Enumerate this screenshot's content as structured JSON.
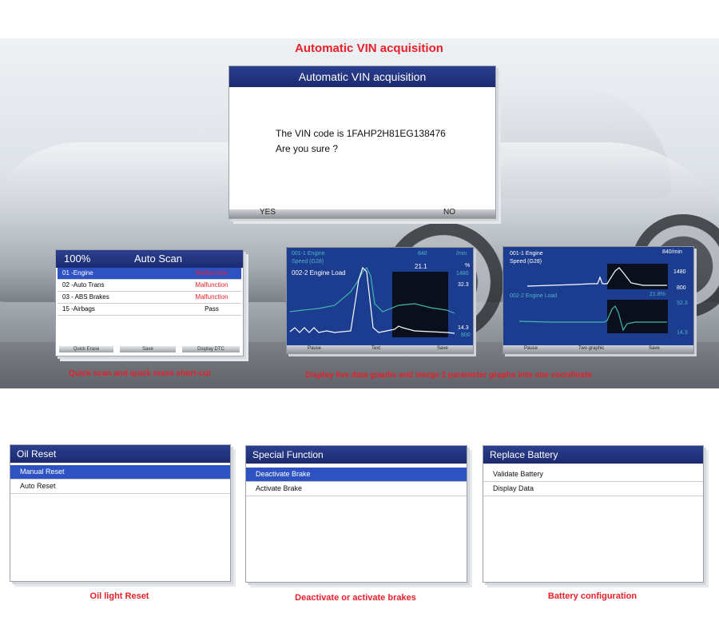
{
  "hero": {
    "title": "Automatic VIN acquisition",
    "caption_left": "Quick scan and quick erase short-cut",
    "caption_right": "Display live data graphs and merge 2 parameter graphs into one coordinate"
  },
  "vin_dialog": {
    "title": "Automatic VIN acquisition",
    "line1": "The VIN code is 1FAHP2H81EG138476",
    "line2": "Are you sure ?",
    "yes": "YES",
    "no": "NO"
  },
  "auto_scan": {
    "percent": "100%",
    "title": "Auto Scan",
    "rows": [
      {
        "name": "01 -Engine",
        "status": "Malfunction"
      },
      {
        "name": "02 -Auto Trans",
        "status": "Malfunction"
      },
      {
        "name": "03 - ABS Brakes",
        "status": "Malfunction"
      },
      {
        "name": "15 -Airbags",
        "status": "Pass"
      }
    ],
    "buttons": [
      "Quick Erase",
      "Save",
      "Display DTC"
    ]
  },
  "graph1": {
    "p1": "001-1  Engine",
    "p1b": "Speed (G28)",
    "p1_unit": "/min",
    "p1_val": "840",
    "p2": "002-2  Engine Load",
    "p2_val": "21.1",
    "p2_unit": "%",
    "v_1480": "1480",
    "v_323": "32.3",
    "v_143": "14.3",
    "v_800": "800",
    "buttons": [
      "Pause",
      "Text",
      "Save"
    ]
  },
  "graph2": {
    "p1": "001-1  Engine",
    "p1b": "Speed (G28)",
    "p1_val": "840/min",
    "p2": "002-2 Engine Load",
    "p2_val": "21.8%",
    "v_1480": "1480",
    "v_800": "800",
    "v_323": "32.3",
    "v_143": "14.3",
    "buttons": [
      "Pause",
      "Two graphic",
      "Save"
    ]
  },
  "oil_reset": {
    "title": "Oil Reset",
    "items": [
      "Manual Reset",
      "Auto Reset"
    ],
    "caption": "Oil light Reset"
  },
  "special_function": {
    "title": "Special Function",
    "items": [
      "Deactivate Brake",
      "Activate Brake"
    ],
    "caption": "Deactivate or activate brakes"
  },
  "replace_battery": {
    "title": "Replace Battery",
    "items": [
      "Validate Battery",
      "Display Data"
    ],
    "caption": "Battery configuration"
  },
  "colors": {
    "title_blue": "#1c2b70",
    "select_blue": "#2f52c3",
    "caption_red": "#e8202a",
    "graph_bg": "#1c3c8f"
  }
}
